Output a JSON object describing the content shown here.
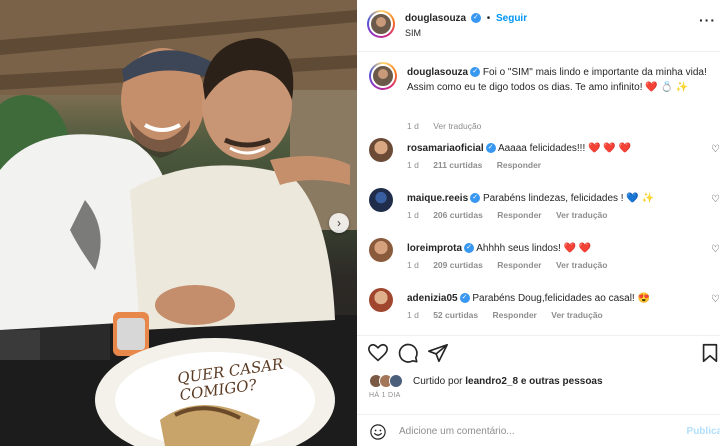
{
  "post": {
    "image_caption_text": "QUER CASAR COMIGO?",
    "carousel_next_icon": "chevron-right-icon"
  },
  "header": {
    "username": "douglasouza",
    "separator": "•",
    "follow_label": "Seguir",
    "subtitle": "SIM",
    "more_icon": "more-options-icon"
  },
  "caption": {
    "username": "douglasouza",
    "text": "Foi o \"SIM\" mais lindo e importante da minha vida! Assim como eu te digo todos os dias. Te amo infinito! ❤️ 💍 ✨",
    "time": "1 d",
    "translate": "Ver tradução"
  },
  "comments": [
    {
      "username": "rosamariaoficial",
      "verified": true,
      "text": "Aaaaa felicidades!!! ❤️ ❤️ ❤️",
      "time": "1 d",
      "likes": "211 curtidas",
      "reply": "Responder",
      "translate": ""
    },
    {
      "username": "maique.reeis",
      "verified": true,
      "text": "Parabéns lindezas, felicidades ! 💙 ✨",
      "time": "1 d",
      "likes": "206 curtidas",
      "reply": "Responder",
      "translate": "Ver tradução"
    },
    {
      "username": "loreimprota",
      "verified": true,
      "text": "Ahhhh seus lindos! ❤️ ❤️",
      "time": "1 d",
      "likes": "209 curtidas",
      "reply": "Responder",
      "translate": "Ver tradução"
    },
    {
      "username": "adenizia05",
      "verified": true,
      "text": "Parabéns Doug,felicidades ao casal! 😍",
      "time": "1 d",
      "likes": "52 curtidas",
      "reply": "Responder",
      "translate": "Ver tradução"
    }
  ],
  "actions": {
    "like_icon": "heart-icon",
    "comment_icon": "comment-icon",
    "share_icon": "share-icon",
    "save_icon": "bookmark-icon"
  },
  "likes_summary": {
    "prefix": "Curtido por",
    "user": "leandro2_8",
    "suffix": "e outras pessoas"
  },
  "date_label": "HÁ 1 DIA",
  "add_comment": {
    "placeholder": "Adicione um comentário...",
    "publish_label": "Publicar",
    "emoji_icon": "emoji-icon"
  },
  "colors": {
    "accent": "#0095f6",
    "verified": "#3897f0",
    "heart_red": "#ed4956",
    "muted": "#8e8e8e"
  }
}
